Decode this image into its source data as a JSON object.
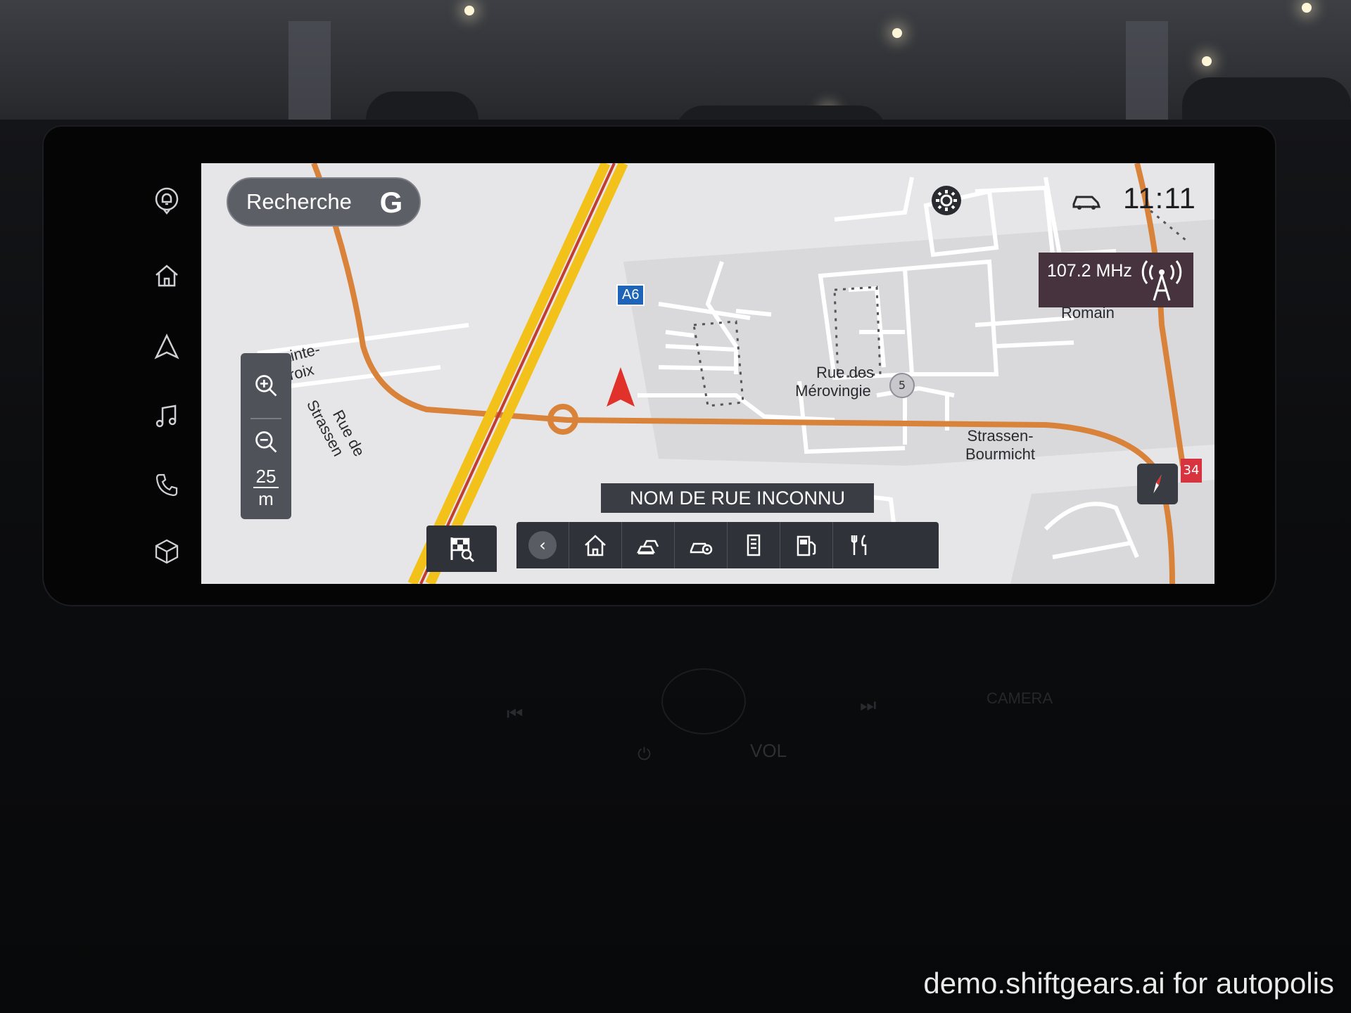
{
  "search": {
    "label": "Recherche",
    "badge": "G"
  },
  "status": {
    "time": "11:11"
  },
  "radio": {
    "frequency": "107.2 MHz"
  },
  "zoom": {
    "scale_value": "25",
    "scale_unit": "m"
  },
  "map": {
    "current_street": "NOM DE RUE INCONNU",
    "highway_shield": "A6",
    "poi_number": "5",
    "labels": {
      "sainte_croix_line1": "al Sainte-",
      "sainte_croix_line2": "Croix",
      "rue_de": "Rue de",
      "strassen": "Strassen",
      "merovingiens_line1": "Rue des",
      "merovingiens_line2": "Mérovingie",
      "romain": "Romain",
      "strassen_bourmicht_line1": "Strassen-",
      "strassen_bourmicht_line2": "Bourmicht"
    },
    "edge_tab": "34"
  },
  "hardware": {
    "vol": "VOL",
    "camera": "CAMERA"
  },
  "watermark": "demo.shiftgears.ai for autopolis",
  "icons": {
    "rail": [
      "notification-icon",
      "home-icon",
      "navigation-icon",
      "music-icon",
      "phone-icon",
      "apps-cube-icon"
    ],
    "toolbar": [
      "back-icon",
      "home-dest-icon",
      "traffic-icon",
      "car-settings-icon",
      "parking-icon",
      "fuel-icon",
      "restaurant-icon"
    ]
  },
  "colors": {
    "highway": "#f2c21a",
    "road_orange": "#d9823a",
    "radio_bg": "#47333d",
    "vehicle_arrow": "#e0312b"
  }
}
